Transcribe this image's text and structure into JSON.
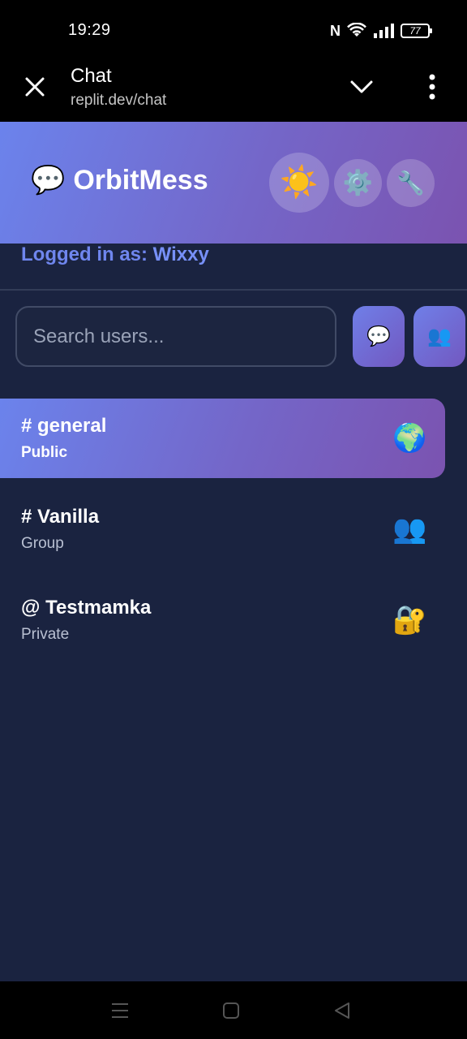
{
  "status_bar": {
    "time": "19:29",
    "battery": "77"
  },
  "browser": {
    "title": "Chat",
    "url": "replit.dev/chat"
  },
  "app": {
    "title": "OrbitMess",
    "title_emoji": "💬",
    "header_buttons": {
      "theme": "☀️",
      "settings": "⚙️",
      "tools": "🔧"
    },
    "logged_in_label": "Logged in as:",
    "username": "Wixxy",
    "search_placeholder": "Search users...",
    "action_buttons": {
      "new_chat": "💬",
      "new_group": "👥"
    },
    "channels": [
      {
        "name": "# general",
        "type": "Public",
        "icon": "🌍",
        "active": true
      },
      {
        "name": "# Vanilla",
        "type": "Group",
        "icon": "👥",
        "active": false
      },
      {
        "name": "@ Testmamka",
        "type": "Private",
        "icon": "🔐",
        "active": false
      }
    ]
  },
  "icons": {
    "close": "close-icon",
    "chevron": "chevron-down-icon",
    "menu": "more-vert-icon",
    "nav_recent": "menu-lines-icon",
    "nav_home": "square-icon",
    "nav_back": "triangle-back-icon"
  },
  "colors": {
    "accent": "#6f86ee",
    "background": "#1a2340",
    "gradient_start": "#6b83ec",
    "gradient_end": "#7b53b0"
  }
}
